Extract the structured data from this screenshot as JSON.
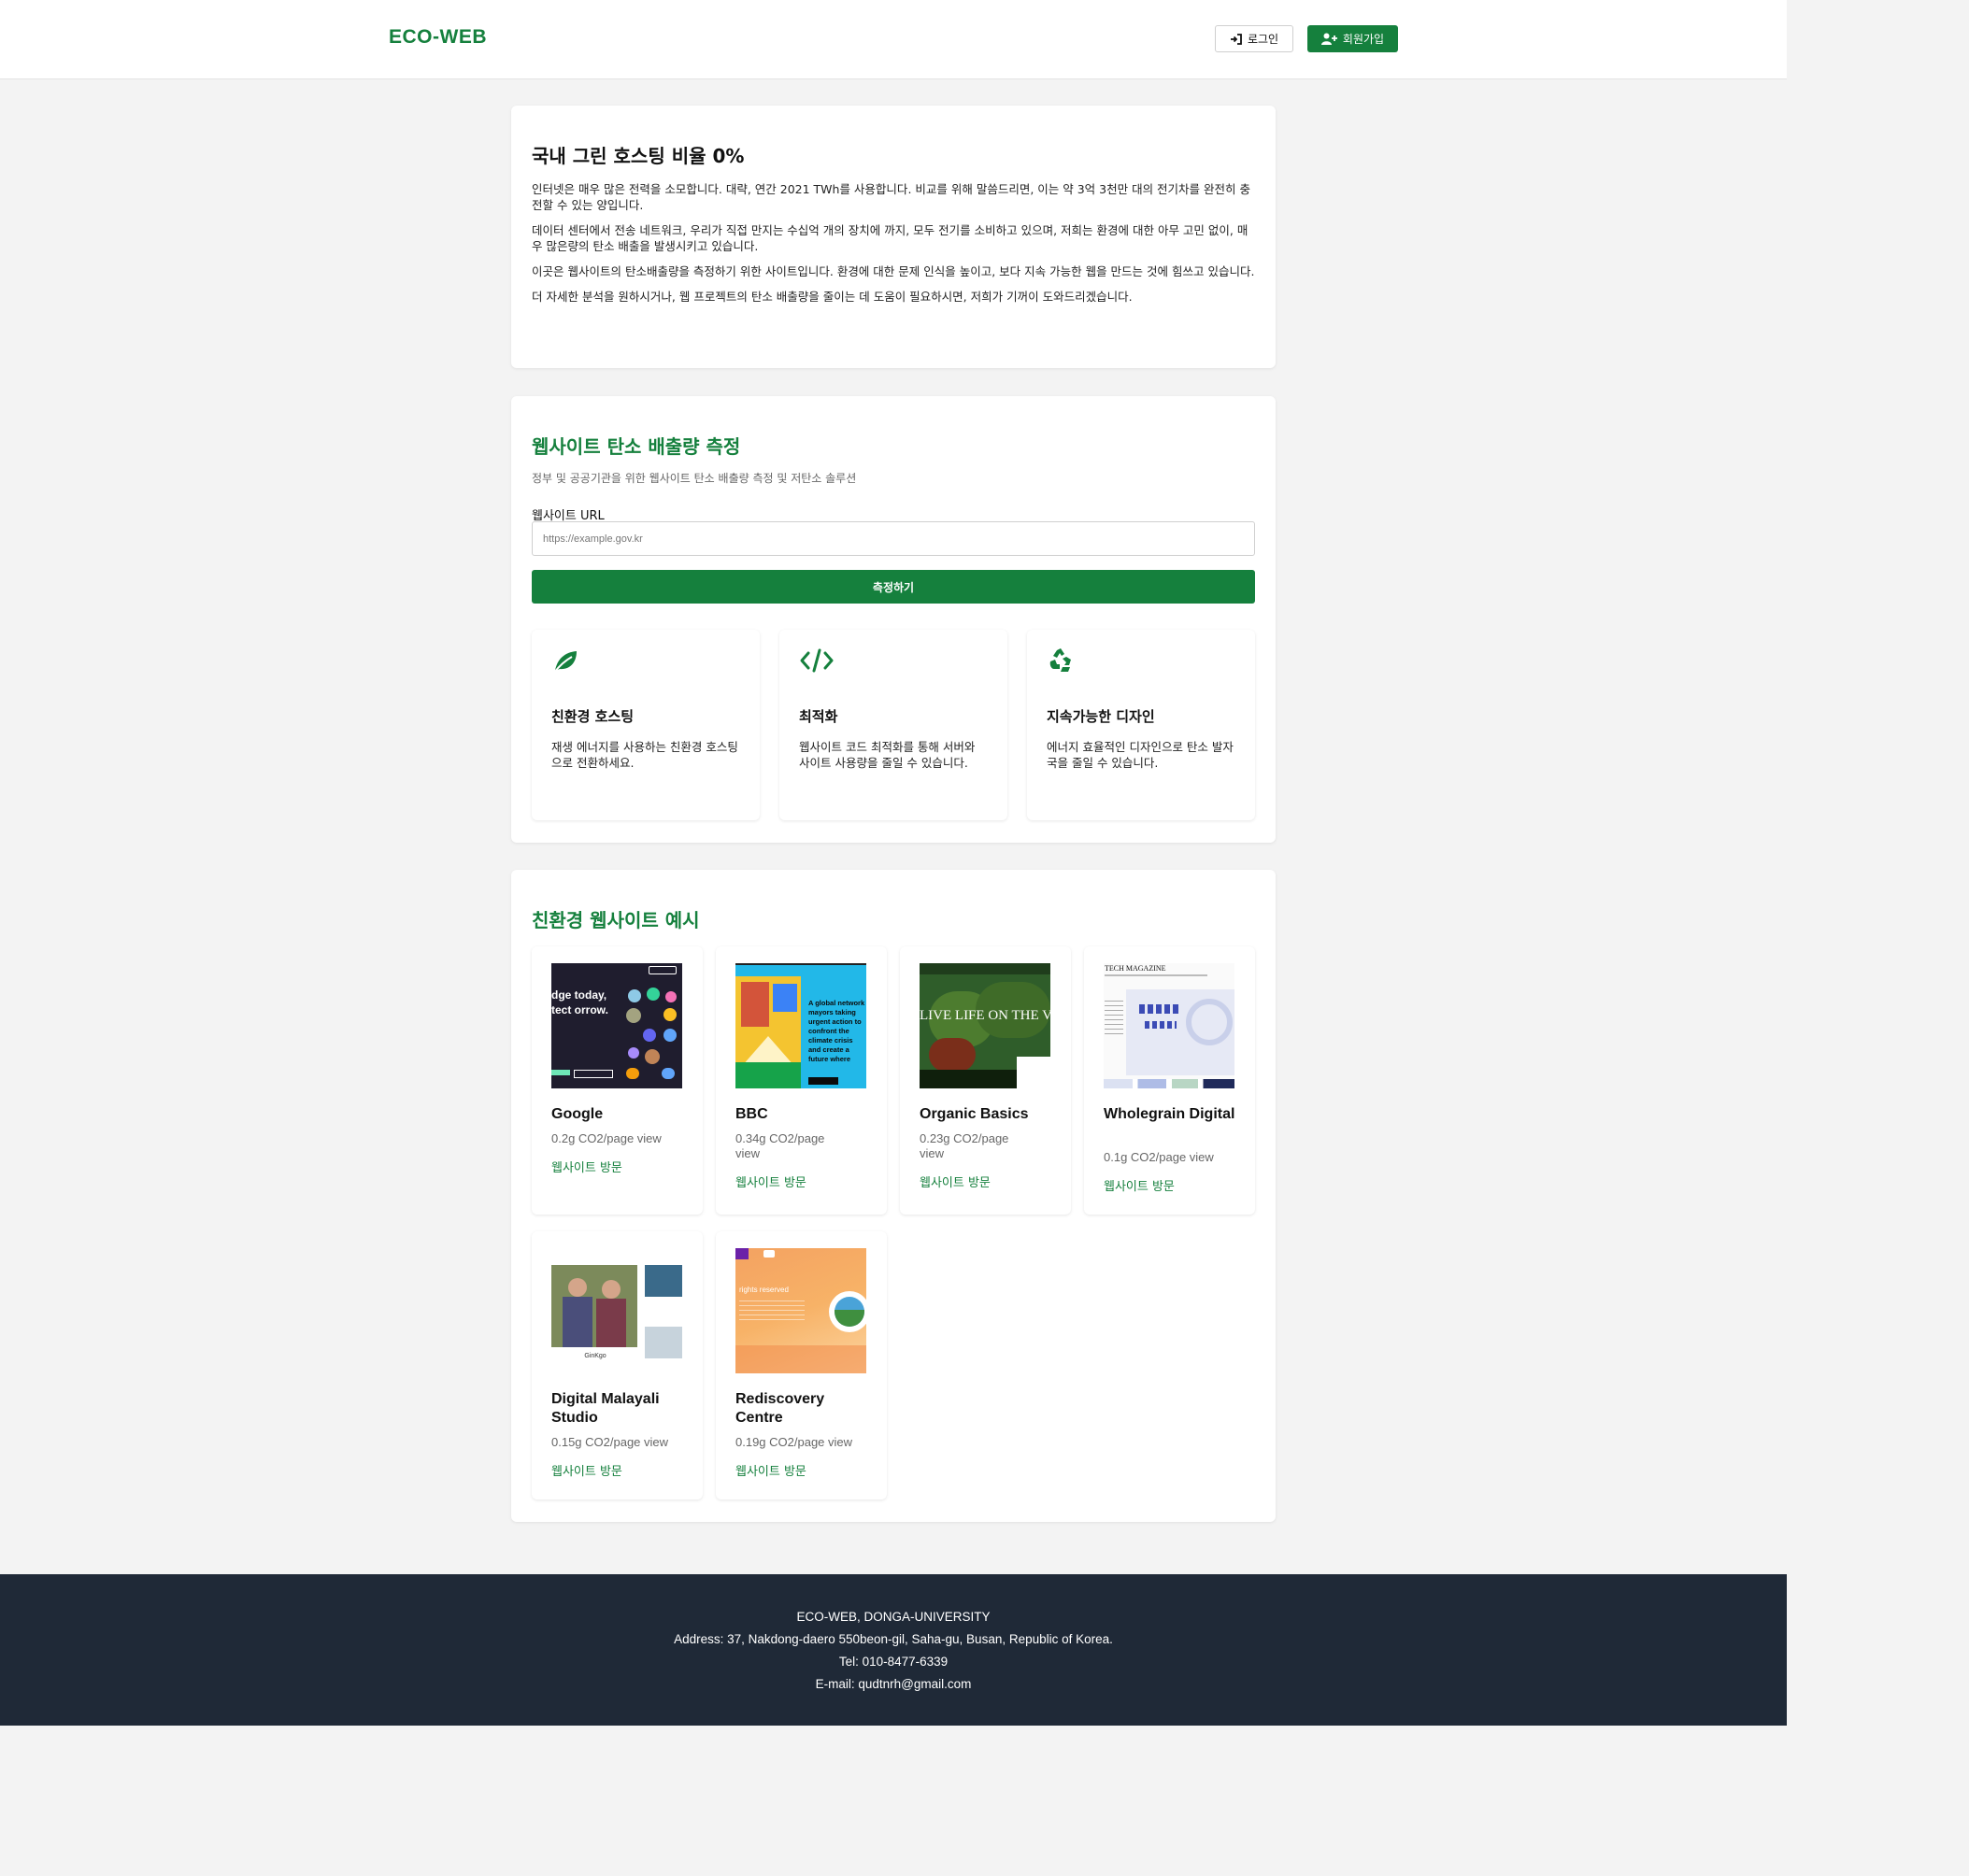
{
  "header": {
    "logo": "ECO-WEB",
    "login_label": "로그인",
    "signup_label": "회원가입"
  },
  "intro": {
    "title": "국내 그린 호스팅 비율 0%",
    "paragraphs": [
      "인터넷은 매우 많은 전력을 소모합니다. 대략, 연간 2021 TWh를 사용합니다. 비교를 위해 말씀드리면, 이는 약 3억 3천만 대의 전기차를 완전히 충전할 수 있는 양입니다.",
      "데이터 센터에서 전송 네트워크, 우리가 직접 만지는 수십억 개의 장치에 까지, 모두 전기를 소비하고 있으며, 저희는 환경에 대한 아무 고민 없이, 매우 많은량의 탄소 배출을 발생시키고 있습니다.",
      "이곳은 웹사이트의 탄소배출량을 측정하기 위한 사이트입니다. 환경에 대한 문제 인식을 높이고, 보다 지속 가능한 웹을 만드는 것에 힘쓰고 있습니다.",
      "더 자세한 분석을 원하시거나, 웹 프로젝트의 탄소 배출량을 줄이는 데 도움이 필요하시면, 저희가 기꺼이 도와드리겠습니다."
    ]
  },
  "measure": {
    "title": "웹사이트 탄소 배출량 측정",
    "subtitle": "정부 및 공공기관을 위한 웹사이트 탄소 배출량 측정 및 저탄소 솔루션",
    "url_label": "웹사이트 URL",
    "url_placeholder": "https://example.gov.kr",
    "url_value": "",
    "button_label": "측정하기",
    "features": [
      {
        "icon": "leaf-icon",
        "title": "친환경 호스팅",
        "desc": "재생 에너지를 사용하는 친환경 호스팅으로 전환하세요."
      },
      {
        "icon": "code-icon",
        "title": "최적화",
        "desc": "웹사이트 코드 최적화를 통해 서버와 사이트 사용량을 줄일 수 있습니다."
      },
      {
        "icon": "recycle-icon",
        "title": "지속가능한 디자인",
        "desc": "에너지 효율적인 디자인으로 탄소 발자국을 줄일 수 있습니다."
      }
    ],
    "accent": "#15803d"
  },
  "examples": {
    "title": "친환경 웹사이트 예시",
    "link_label": "웹사이트 방문",
    "items": [
      {
        "name": "Google",
        "co2": "0.2g CO2/page view",
        "thumb_text": "dge today, tect orrow."
      },
      {
        "name": "BBC",
        "co2": "0.34g CO2/page view",
        "thumb_text": "A global network mayors taking urgent action to confront the climate crisis and create a future where everyone can thrive"
      },
      {
        "name": "Organic Basics",
        "co2": "0.23g CO2/page view",
        "thumb_text": "LIVE LIFE ON THE VEG"
      },
      {
        "name": "Wholegrain Digital",
        "co2": "0.1g CO2/page view",
        "thumb_text": "TECH MAGAZINE"
      },
      {
        "name": "Digital Malayali Studio",
        "co2": "0.15g CO2/page view",
        "thumb_text": "GinKgo"
      },
      {
        "name": "Rediscovery Centre",
        "co2": "0.19g CO2/page view",
        "thumb_text": "rights reserved"
      }
    ]
  },
  "footer": {
    "line1": "ECO-WEB, DONGA-UNIVERSITY",
    "line2": "Address: 37, Nakdong-daero 550beon-gil, Saha-gu, Busan, Republic of Korea.",
    "line3": "Tel: 010-8477-6339",
    "line4": "E-mail: qudtnrh@gmail.com"
  }
}
